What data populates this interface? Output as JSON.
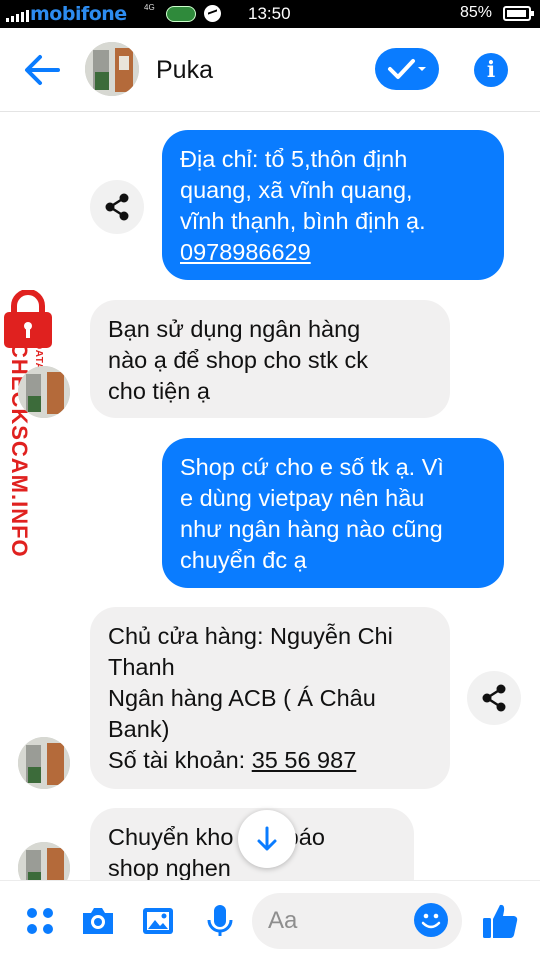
{
  "status_bar": {
    "carrier": "mobifone",
    "network": "4G",
    "time": "13:50",
    "battery": "85%"
  },
  "header": {
    "contact_name": "Puka"
  },
  "messages": [
    {
      "direction": "outgoing",
      "lines": [
        "Địa chỉ: tổ 5,thôn định",
        "quang, xã vĩnh quang,",
        "vĩnh thạnh, bình định ạ."
      ],
      "link": "0978986629"
    },
    {
      "direction": "incoming",
      "lines": [
        "Bạn sử dụng ngân hàng",
        "nào ạ để shop cho stk ck",
        "cho tiện ạ"
      ]
    },
    {
      "direction": "outgoing",
      "lines": [
        "Shop cứ cho e số tk ạ.  Vì",
        "e dùng vietpay nên hầu",
        "như ngân hàng nào cũng",
        "chuyển đc ạ"
      ]
    },
    {
      "direction": "incoming",
      "lines": [
        "Chủ cửa hàng: Nguyễn Chi",
        "Thanh",
        "Ngân hàng ACB ( Á Châu",
        "Bank)"
      ],
      "last_prefix": "Số tài khoản: ",
      "link": "35 56 987"
    },
    {
      "direction": "incoming",
      "lines": [
        "Chuyển kho          ông báo",
        "shop nghen"
      ]
    }
  ],
  "watermark": {
    "main": "CHECKSCAM.INFO",
    "sub": "DATA CENTER"
  },
  "composer": {
    "placeholder": "Aa"
  },
  "icons": {
    "back": "back-arrow-icon",
    "check": "check-icon",
    "info": "info-icon",
    "share": "share-icon",
    "menu": "grid-dots-icon",
    "camera": "camera-icon",
    "gallery": "image-icon",
    "mic": "microphone-icon",
    "emoji": "emoji-icon",
    "like": "thumbs-up-icon",
    "scroll": "arrow-down-icon"
  },
  "colors": {
    "accent": "#0a7cff",
    "incoming_bubble": "#f1f0f0",
    "watermark": "#e0211f"
  }
}
